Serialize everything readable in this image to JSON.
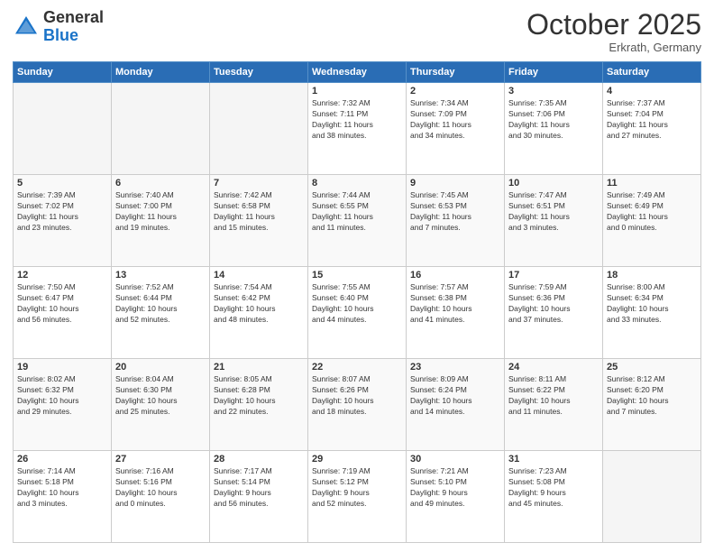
{
  "header": {
    "logo_general": "General",
    "logo_blue": "Blue",
    "month": "October 2025",
    "location": "Erkrath, Germany"
  },
  "days_of_week": [
    "Sunday",
    "Monday",
    "Tuesday",
    "Wednesday",
    "Thursday",
    "Friday",
    "Saturday"
  ],
  "weeks": [
    [
      {
        "day": "",
        "info": ""
      },
      {
        "day": "",
        "info": ""
      },
      {
        "day": "",
        "info": ""
      },
      {
        "day": "1",
        "info": "Sunrise: 7:32 AM\nSunset: 7:11 PM\nDaylight: 11 hours\nand 38 minutes."
      },
      {
        "day": "2",
        "info": "Sunrise: 7:34 AM\nSunset: 7:09 PM\nDaylight: 11 hours\nand 34 minutes."
      },
      {
        "day": "3",
        "info": "Sunrise: 7:35 AM\nSunset: 7:06 PM\nDaylight: 11 hours\nand 30 minutes."
      },
      {
        "day": "4",
        "info": "Sunrise: 7:37 AM\nSunset: 7:04 PM\nDaylight: 11 hours\nand 27 minutes."
      }
    ],
    [
      {
        "day": "5",
        "info": "Sunrise: 7:39 AM\nSunset: 7:02 PM\nDaylight: 11 hours\nand 23 minutes."
      },
      {
        "day": "6",
        "info": "Sunrise: 7:40 AM\nSunset: 7:00 PM\nDaylight: 11 hours\nand 19 minutes."
      },
      {
        "day": "7",
        "info": "Sunrise: 7:42 AM\nSunset: 6:58 PM\nDaylight: 11 hours\nand 15 minutes."
      },
      {
        "day": "8",
        "info": "Sunrise: 7:44 AM\nSunset: 6:55 PM\nDaylight: 11 hours\nand 11 minutes."
      },
      {
        "day": "9",
        "info": "Sunrise: 7:45 AM\nSunset: 6:53 PM\nDaylight: 11 hours\nand 7 minutes."
      },
      {
        "day": "10",
        "info": "Sunrise: 7:47 AM\nSunset: 6:51 PM\nDaylight: 11 hours\nand 3 minutes."
      },
      {
        "day": "11",
        "info": "Sunrise: 7:49 AM\nSunset: 6:49 PM\nDaylight: 11 hours\nand 0 minutes."
      }
    ],
    [
      {
        "day": "12",
        "info": "Sunrise: 7:50 AM\nSunset: 6:47 PM\nDaylight: 10 hours\nand 56 minutes."
      },
      {
        "day": "13",
        "info": "Sunrise: 7:52 AM\nSunset: 6:44 PM\nDaylight: 10 hours\nand 52 minutes."
      },
      {
        "day": "14",
        "info": "Sunrise: 7:54 AM\nSunset: 6:42 PM\nDaylight: 10 hours\nand 48 minutes."
      },
      {
        "day": "15",
        "info": "Sunrise: 7:55 AM\nSunset: 6:40 PM\nDaylight: 10 hours\nand 44 minutes."
      },
      {
        "day": "16",
        "info": "Sunrise: 7:57 AM\nSunset: 6:38 PM\nDaylight: 10 hours\nand 41 minutes."
      },
      {
        "day": "17",
        "info": "Sunrise: 7:59 AM\nSunset: 6:36 PM\nDaylight: 10 hours\nand 37 minutes."
      },
      {
        "day": "18",
        "info": "Sunrise: 8:00 AM\nSunset: 6:34 PM\nDaylight: 10 hours\nand 33 minutes."
      }
    ],
    [
      {
        "day": "19",
        "info": "Sunrise: 8:02 AM\nSunset: 6:32 PM\nDaylight: 10 hours\nand 29 minutes."
      },
      {
        "day": "20",
        "info": "Sunrise: 8:04 AM\nSunset: 6:30 PM\nDaylight: 10 hours\nand 25 minutes."
      },
      {
        "day": "21",
        "info": "Sunrise: 8:05 AM\nSunset: 6:28 PM\nDaylight: 10 hours\nand 22 minutes."
      },
      {
        "day": "22",
        "info": "Sunrise: 8:07 AM\nSunset: 6:26 PM\nDaylight: 10 hours\nand 18 minutes."
      },
      {
        "day": "23",
        "info": "Sunrise: 8:09 AM\nSunset: 6:24 PM\nDaylight: 10 hours\nand 14 minutes."
      },
      {
        "day": "24",
        "info": "Sunrise: 8:11 AM\nSunset: 6:22 PM\nDaylight: 10 hours\nand 11 minutes."
      },
      {
        "day": "25",
        "info": "Sunrise: 8:12 AM\nSunset: 6:20 PM\nDaylight: 10 hours\nand 7 minutes."
      }
    ],
    [
      {
        "day": "26",
        "info": "Sunrise: 7:14 AM\nSunset: 5:18 PM\nDaylight: 10 hours\nand 3 minutes."
      },
      {
        "day": "27",
        "info": "Sunrise: 7:16 AM\nSunset: 5:16 PM\nDaylight: 10 hours\nand 0 minutes."
      },
      {
        "day": "28",
        "info": "Sunrise: 7:17 AM\nSunset: 5:14 PM\nDaylight: 9 hours\nand 56 minutes."
      },
      {
        "day": "29",
        "info": "Sunrise: 7:19 AM\nSunset: 5:12 PM\nDaylight: 9 hours\nand 52 minutes."
      },
      {
        "day": "30",
        "info": "Sunrise: 7:21 AM\nSunset: 5:10 PM\nDaylight: 9 hours\nand 49 minutes."
      },
      {
        "day": "31",
        "info": "Sunrise: 7:23 AM\nSunset: 5:08 PM\nDaylight: 9 hours\nand 45 minutes."
      },
      {
        "day": "",
        "info": ""
      }
    ]
  ]
}
